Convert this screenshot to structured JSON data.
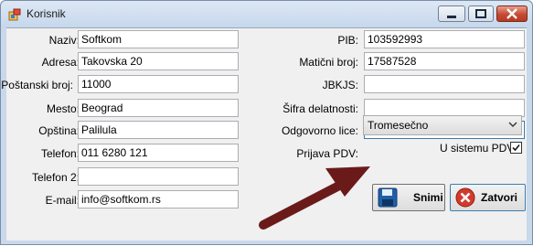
{
  "window": {
    "title": "Korisnik"
  },
  "form_left": [
    {
      "label": "Naziv:",
      "value": "Softkom"
    },
    {
      "label": "Adresa:",
      "value": "Takovska 20"
    },
    {
      "label": "Poštanski broj:",
      "value": "11000"
    },
    {
      "label": "Mesto:",
      "value": "Beograd"
    },
    {
      "label": "Opština:",
      "value": "Palilula"
    },
    {
      "label": "Telefon:",
      "value": "011 6280 121"
    },
    {
      "label": "Telefon 2:",
      "value": ""
    },
    {
      "label": "E-mail:",
      "value": "info@softkom.rs"
    }
  ],
  "form_right": [
    {
      "label": "PIB:",
      "value": "103592993"
    },
    {
      "label": "Matični broj:",
      "value": "17587528"
    },
    {
      "label": "JBKJS:",
      "value": ""
    },
    {
      "label": "Šifra delatnosti:",
      "value": ""
    },
    {
      "label": "Odgovorno lice:",
      "value": ""
    }
  ],
  "pdv": {
    "label": "Prijava PDV:",
    "selected": "Tromesečno",
    "checkbox_label": "U sistemu PDV",
    "checked": true
  },
  "buttons": {
    "save": "Snimi",
    "close": "Zatvori"
  },
  "colors": {
    "arrow": "#6b1a1a",
    "titlebar": "#c9d8ea"
  }
}
